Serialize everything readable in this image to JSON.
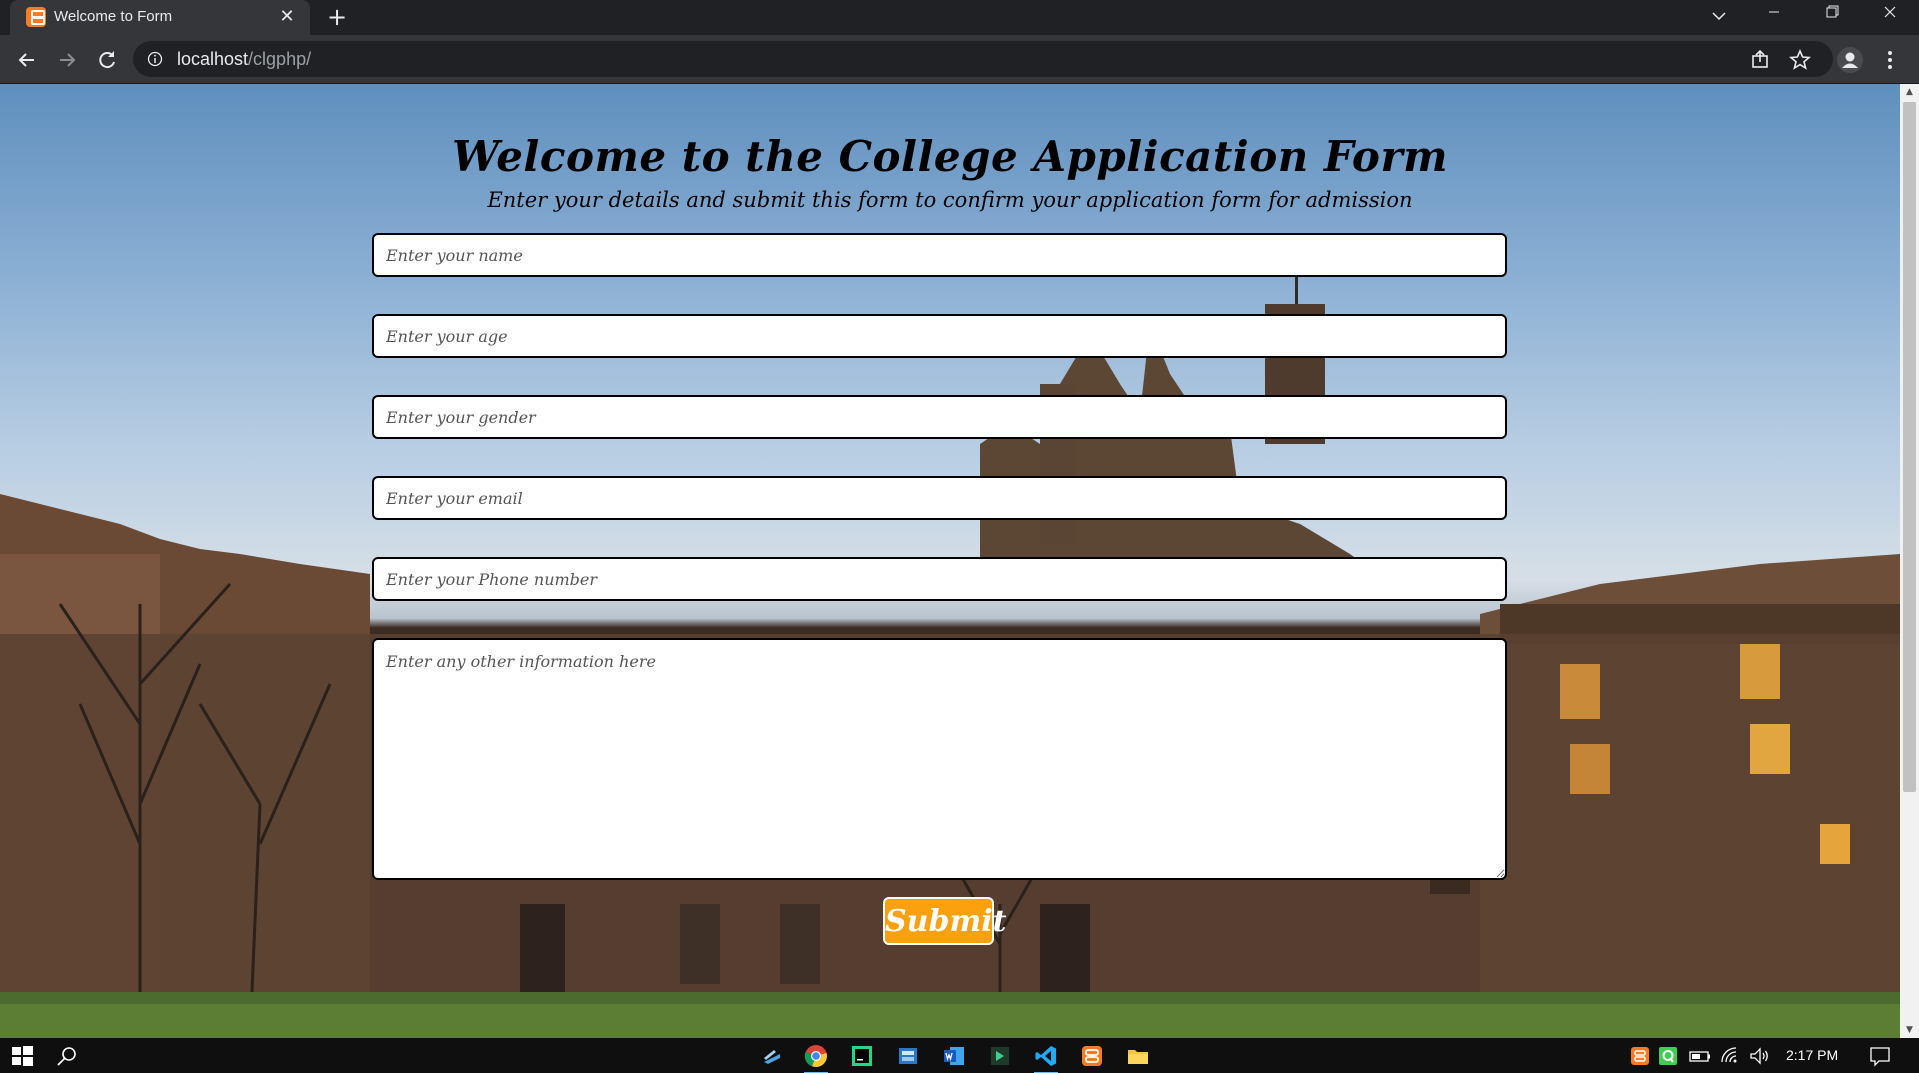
{
  "browser": {
    "tab_title": "Welcome to Form",
    "tab_close": "✕",
    "new_tab": "+",
    "url_host": "localhost",
    "url_path": "/clgphp/"
  },
  "form": {
    "title": "Welcome to the College Application Form",
    "subtitle": "Enter your details and submit this form to confirm your application form for admission",
    "name_placeholder": "Enter your name",
    "age_placeholder": "Enter your age",
    "gender_placeholder": "Enter your gender",
    "email_placeholder": "Enter your email",
    "phone_placeholder": "Enter your Phone number",
    "info_placeholder": "Enter any other information here",
    "submit_label": "Submit"
  },
  "scrollbar": {
    "up": "▲",
    "down": "▼"
  },
  "taskbar": {
    "time": "2:17 PM",
    "apps": [
      "windows-start-icon",
      "search-icon",
      "task-view-icon",
      "chrome-icon",
      "pycharm-icon",
      "calculator-icon",
      "word-icon",
      "terminal-icon",
      "vscode-icon",
      "xampp-icon",
      "file-explorer-icon"
    ],
    "tray": [
      "xampp-tray-icon",
      "qt-tray-icon",
      "battery-icon",
      "wifi-icon",
      "volume-icon",
      "notification-icon"
    ]
  },
  "colors": {
    "accent": "#fba00e",
    "xampp": "#fb7a24",
    "chrome_dark": "#202124",
    "chrome_toolbar": "#35363a"
  }
}
